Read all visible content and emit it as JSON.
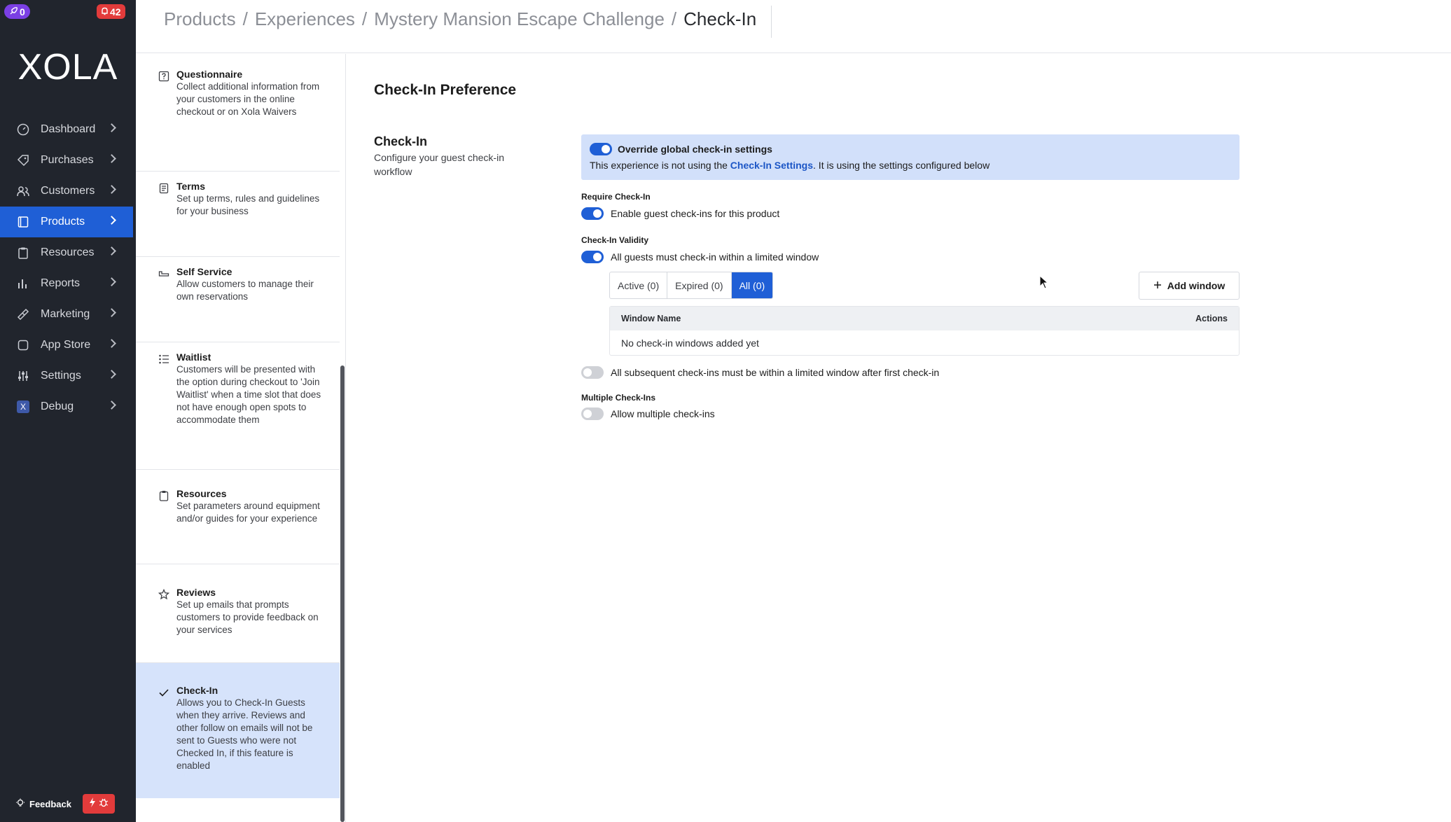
{
  "badges": {
    "notifications": "0",
    "alerts": "42"
  },
  "brand": {
    "logo": "XOLA"
  },
  "nav": [
    {
      "label": "Dashboard",
      "icon": "dashboard-icon"
    },
    {
      "label": "Purchases",
      "icon": "tag-icon"
    },
    {
      "label": "Customers",
      "icon": "users-icon"
    },
    {
      "label": "Products",
      "icon": "book-icon",
      "active": true
    },
    {
      "label": "Resources",
      "icon": "clipboard-icon"
    },
    {
      "label": "Reports",
      "icon": "bar-chart-icon"
    },
    {
      "label": "Marketing",
      "icon": "megaphone-icon"
    },
    {
      "label": "App Store",
      "icon": "app-store-icon"
    },
    {
      "label": "Settings",
      "icon": "sliders-icon"
    },
    {
      "label": "Debug",
      "icon": "x-icon"
    }
  ],
  "footer": {
    "feedback": "Feedback"
  },
  "breadcrumb": [
    "Products",
    "Experiences",
    "Mystery Mansion Escape Challenge",
    "Check-In"
  ],
  "subnav": [
    {
      "title": "Questionnaire",
      "desc": "Collect additional information from your customers in the online checkout or on Xola Waivers"
    },
    {
      "title": "Terms",
      "desc": "Set up terms, rules and guidelines for your business"
    },
    {
      "title": "Self Service",
      "desc": "Allow customers to manage their own reservations"
    },
    {
      "title": "Waitlist",
      "desc": "Customers will be presented with the option during checkout to 'Join Waitlist' when a time slot that does not have enough open spots to accommodate them"
    },
    {
      "title": "Resources",
      "desc": "Set parameters around equipment and/or guides for your experience"
    },
    {
      "title": "Reviews",
      "desc": "Set up emails that prompts customers to provide feedback on your services"
    },
    {
      "title": "Check-In",
      "desc": "Allows you to Check-In Guests when they arrive. Reviews and other follow on emails will not be sent to Guests who were not Checked In, if this feature is enabled"
    }
  ],
  "main": {
    "title": "Check-In Preference",
    "section_title": "Check-In",
    "section_desc": "Configure your guest check-in workflow",
    "override": {
      "title": "Override global check-in settings",
      "text_before": "This experience is not using the ",
      "link": "Check-In Settings",
      "text_after": ". It is using the settings configured below",
      "enabled": true
    },
    "require_label": "Require Check-In",
    "require_toggle": "Enable guest check-ins for this product",
    "validity_label": "Check-In Validity",
    "validity_toggle": "All guests must check-in within a limited window",
    "tabs": [
      "Active (0)",
      "Expired (0)",
      "All (0)"
    ],
    "add_window": "Add window",
    "table": {
      "col_name": "Window Name",
      "col_actions": "Actions",
      "empty": "No check-in windows added yet"
    },
    "subsequent_toggle": "All subsequent check-ins must be within a limited window after first check-in",
    "multiple_label": "Multiple Check-Ins",
    "multiple_toggle": "Allow multiple check-ins"
  },
  "colors": {
    "primary": "#1f5fd6",
    "sidebar": "#21252d",
    "highlight": "#d2e0fa",
    "danger": "#e23b3b"
  }
}
